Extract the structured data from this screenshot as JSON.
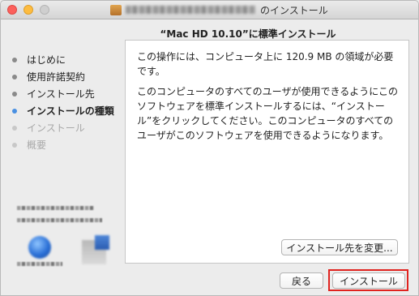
{
  "window": {
    "title_suffix": "のインストール",
    "title_prefix_blurred": true
  },
  "header": {
    "subtitle": "“Mac HD 10.10”に標準インストール"
  },
  "sidebar": {
    "steps": [
      {
        "label": "はじめに",
        "state": "done"
      },
      {
        "label": "使用許諾契約",
        "state": "done"
      },
      {
        "label": "インストール先",
        "state": "done"
      },
      {
        "label": "インストールの種類",
        "state": "current"
      },
      {
        "label": "インストール",
        "state": "future"
      },
      {
        "label": "概要",
        "state": "future"
      }
    ]
  },
  "content": {
    "paragraph1": "この操作には、コンピュータ上に 120.9 MB の領域が必要です。",
    "paragraph2": "このコンピュータのすべてのユーザが使用できるようにこのソフトウェアを標準インストールするには、“インストール”をクリックしてください。このコンピュータのすべてのユーザがこのソフトウェアを使用できるようになります。"
  },
  "buttons": {
    "change_location": "インストール先を変更...",
    "back": "戻る",
    "install": "インストール"
  },
  "colors": {
    "current_step_dot": "#4a90e2",
    "highlight_border": "#e0231f",
    "close": "#fc605c",
    "minimize": "#fdbc40"
  },
  "icons": [
    "package-icon",
    "globe-icon",
    "installer-box-icon"
  ]
}
